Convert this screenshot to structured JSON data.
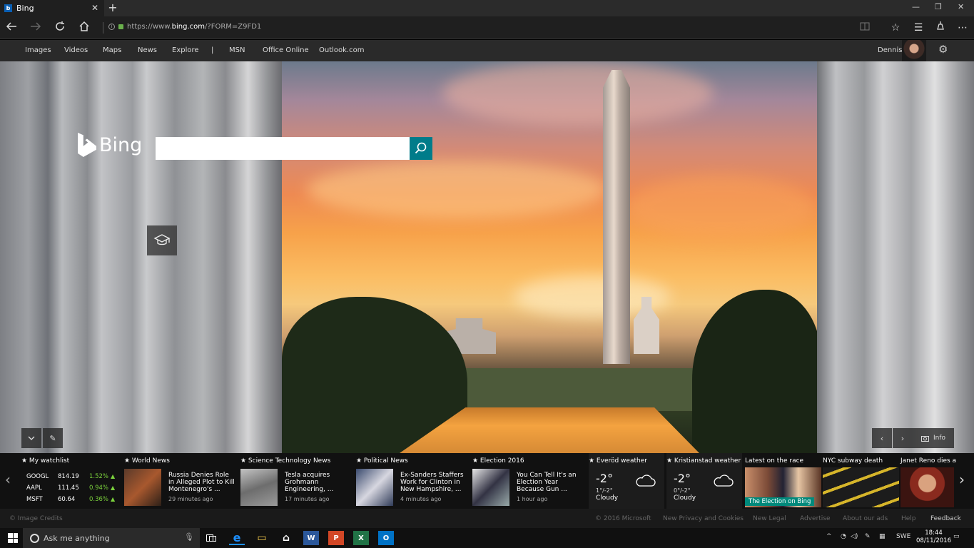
{
  "browser": {
    "tab_title": "Bing",
    "tab_favicon": "b",
    "close_tab": "✕",
    "new_tab": "+",
    "window_controls": [
      "—",
      "❐",
      "✕"
    ],
    "url_scheme": "https://www.",
    "url_host": "bing.com",
    "url_path": "/?FORM=Z9FD1"
  },
  "bing_nav": {
    "links": [
      "Images",
      "Videos",
      "Maps",
      "News",
      "Explore",
      "|",
      "MSN",
      "Office Online",
      "Outlook.com"
    ],
    "user_name": "Dennis"
  },
  "hero": {
    "logo_text": "Bing",
    "search_placeholder": "",
    "info_label": "Info"
  },
  "news_strip": {
    "watchlist": {
      "title": "★ My watchlist",
      "stocks": [
        {
          "symbol": "GOOGL",
          "value": "814.19",
          "change": "1.52%"
        },
        {
          "symbol": "AAPL",
          "value": "111.45",
          "change": "0.94%"
        },
        {
          "symbol": "MSFT",
          "value": "60.64",
          "change": "0.36%"
        }
      ]
    },
    "news_cards": [
      {
        "title": "★ World News",
        "headline": "Russia Denies Role in Alleged Plot to Kill Montenegro's ...",
        "time": "29 minutes ago"
      },
      {
        "title": "★ Science Technology News",
        "headline": "Tesla acquires Grohmann Engineering, ...",
        "time": "17 minutes ago"
      },
      {
        "title": "★ Political News",
        "headline": "Ex-Sanders Staffers Work for Clinton in New Hampshire, ...",
        "time": "4 minutes ago"
      },
      {
        "title": "★ Election 2016",
        "headline": "You Can Tell It's an Election Year Because Gun ...",
        "time": "1 hour ago"
      }
    ],
    "weather": [
      {
        "title": "★ Everöd weather",
        "temp": "-2°",
        "range": "1°/-2°",
        "condition": "Cloudy"
      },
      {
        "title": "★ Kristianstad weather",
        "temp": "-2°",
        "range": "0°/-2°",
        "condition": "Cloudy"
      }
    ],
    "image_cards": [
      {
        "title": "Latest on the race",
        "overlay": "The Election on Bing"
      },
      {
        "title": "NYC subway death",
        "overlay": ""
      },
      {
        "title": "Janet Reno dies a",
        "overlay": ""
      }
    ]
  },
  "footer": {
    "image_credits": "© Image Credits",
    "copyright": "© 2016 Microsoft",
    "links": [
      "New Privacy and Cookies",
      "New Legal",
      "Advertise",
      "About our ads",
      "Help",
      "Feedback"
    ]
  },
  "taskbar": {
    "search_placeholder": "Ask me anything",
    "apps": [
      {
        "icon": "edge-icon",
        "glyph": "e",
        "color": "#1e90ff"
      },
      {
        "icon": "file-explorer-icon",
        "glyph": "▭",
        "color": "#f2c94c"
      },
      {
        "icon": "store-icon",
        "glyph": "⌂",
        "color": "#ffffff"
      },
      {
        "icon": "word-icon",
        "glyph": "W",
        "color": "#2b579a"
      },
      {
        "icon": "powerpoint-icon",
        "glyph": "P",
        "color": "#d24726"
      },
      {
        "icon": "excel-icon",
        "glyph": "X",
        "color": "#217346"
      },
      {
        "icon": "outlook-icon",
        "glyph": "O",
        "color": "#0072c6"
      }
    ],
    "language": "SWE",
    "time": "18:44",
    "date": "08/11/2016"
  },
  "colors": {
    "accent_teal": "#007c8a",
    "stock_up": "#7bd13c",
    "overlay_teal": "#00897b"
  }
}
